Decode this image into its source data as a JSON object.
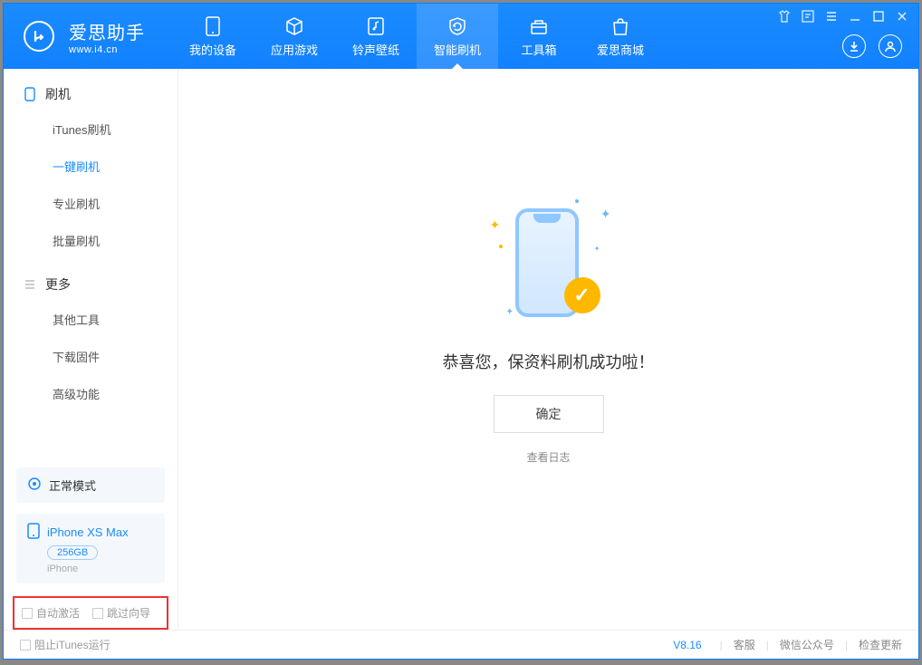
{
  "app": {
    "title": "爱思助手",
    "subtitle": "www.i4.cn"
  },
  "nav": {
    "items": [
      {
        "label": "我的设备"
      },
      {
        "label": "应用游戏"
      },
      {
        "label": "铃声壁纸"
      },
      {
        "label": "智能刷机"
      },
      {
        "label": "工具箱"
      },
      {
        "label": "爱思商城"
      }
    ],
    "active_index": 3
  },
  "sidebar": {
    "group1": {
      "title": "刷机"
    },
    "items1": [
      {
        "label": "iTunes刷机"
      },
      {
        "label": "一键刷机"
      },
      {
        "label": "专业刷机"
      },
      {
        "label": "批量刷机"
      }
    ],
    "group2": {
      "title": "更多"
    },
    "items2": [
      {
        "label": "其他工具"
      },
      {
        "label": "下载固件"
      },
      {
        "label": "高级功能"
      }
    ],
    "active_item": "一键刷机",
    "status": {
      "label": "正常模式"
    },
    "device": {
      "name": "iPhone XS Max",
      "storage": "256GB",
      "type": "iPhone"
    },
    "checks": {
      "auto_activate": "自动激活",
      "skip_guide": "跳过向导"
    }
  },
  "main": {
    "success_text": "恭喜您，保资料刷机成功啦！",
    "confirm_label": "确定",
    "view_log_label": "查看日志"
  },
  "footer": {
    "stop_itunes": "阻止iTunes运行",
    "version": "V8.16",
    "customer_service": "客服",
    "wechat": "微信公众号",
    "check_update": "检查更新"
  }
}
